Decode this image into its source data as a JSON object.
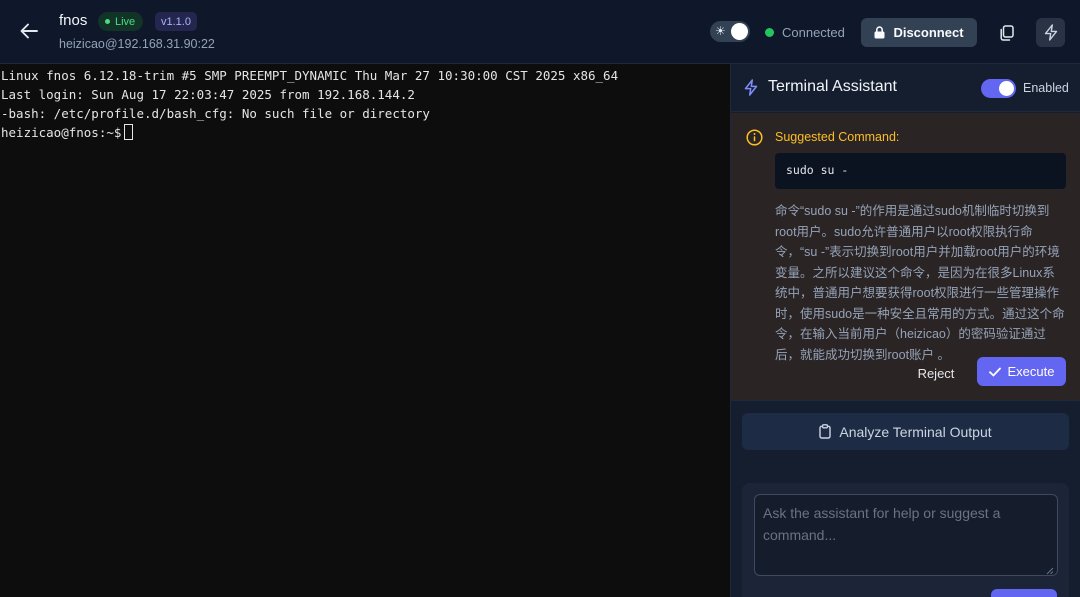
{
  "header": {
    "title": "fnos",
    "live_label": "Live",
    "version": "v1.1.0",
    "subtitle": "heizicao@192.168.31.90:22",
    "theme_icon": "sun-icon",
    "status_label": "Connected",
    "status_color": "#22c55e",
    "disconnect_label": "Disconnect"
  },
  "terminal": {
    "lines": [
      "Linux fnos 6.12.18-trim #5 SMP PREEMPT_DYNAMIC Thu Mar 27 10:30:00 CST 2025 x86_64",
      "Last login: Sun Aug 17 22:03:47 2025 from 192.168.144.2",
      "-bash: /etc/profile.d/bash_cfg: No such file or directory"
    ],
    "prompt": "heizicao@fnos:~$"
  },
  "assistant": {
    "title": "Terminal Assistant",
    "enabled_label": "Enabled",
    "suggest_title": "Suggested Command:",
    "command": "sudo su -",
    "explanation": "命令“sudo su -”的作用是通过sudo机制临时切换到root用户。sudo允许普通用户以root权限执行命令，“su -”表示切换到root用户并加载root用户的环境变量。之所以建议这个命令，是因为在很多Linux系统中，普通用户想要获得root权限进行一些管理操作时，使用sudo是一种安全且常用的方式。通过这个命令，在输入当前用户（heizicao）的密码验证通过后，就能成功切换到root账户 。",
    "reject_label": "Reject",
    "execute_label": "Execute",
    "analyze_label": "Analyze Terminal Output",
    "input_placeholder": "Ask the assistant for help or suggest a command...",
    "accent_color": "#6366f1",
    "warning_color": "#fbbf24"
  }
}
